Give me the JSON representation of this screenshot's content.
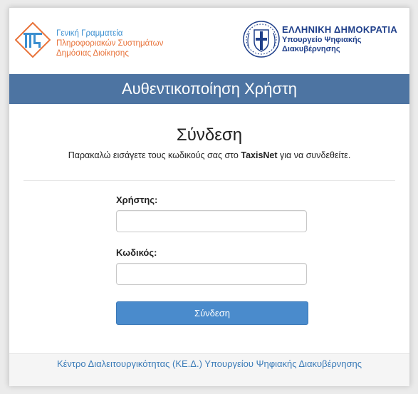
{
  "header": {
    "gsis": {
      "line1": "Γενική Γραμματεία",
      "line2": "Πληροφοριακών Συστημάτων",
      "line3": "Δημόσιας Διοίκησης"
    },
    "gov": {
      "line1": "ΕΛΛΗΝΙΚΗ ΔΗΜΟΚΡΑΤΙΑ",
      "line2": "Υπουργείο Ψηφιακής",
      "line3": "Διακυβέρνησης"
    }
  },
  "banner": {
    "title": "Αυθεντικοποίηση Χρήστη"
  },
  "login": {
    "heading": "Σύνδεση",
    "instructions_before": "Παρακαλώ εισάγετε τους κωδικούς σας στο ",
    "instructions_brand": "TaxisNet",
    "instructions_after": " για να συνδεθείτε.",
    "username_label": "Χρήστης:",
    "username_value": "",
    "password_label": "Κωδικός:",
    "password_value": "",
    "submit_label": "Σύνδεση"
  },
  "footer": {
    "link_text": "Κέντρο Διαλειτουργικότητας (ΚΕ.Δ.) Υπουργείου Ψηφιακής Διακυβέρνησης"
  },
  "colors": {
    "banner_bg": "#4d74a2",
    "button_bg": "#4a8bcc",
    "gsis_blue": "#3b8fd0",
    "gsis_orange": "#e8733a",
    "gov_blue": "#1f3f8a",
    "footer_link": "#3c7cb8"
  },
  "icons": {
    "gsis_logo": "gsis-logo-icon",
    "gov_seal": "greek-coat-of-arms-icon"
  }
}
